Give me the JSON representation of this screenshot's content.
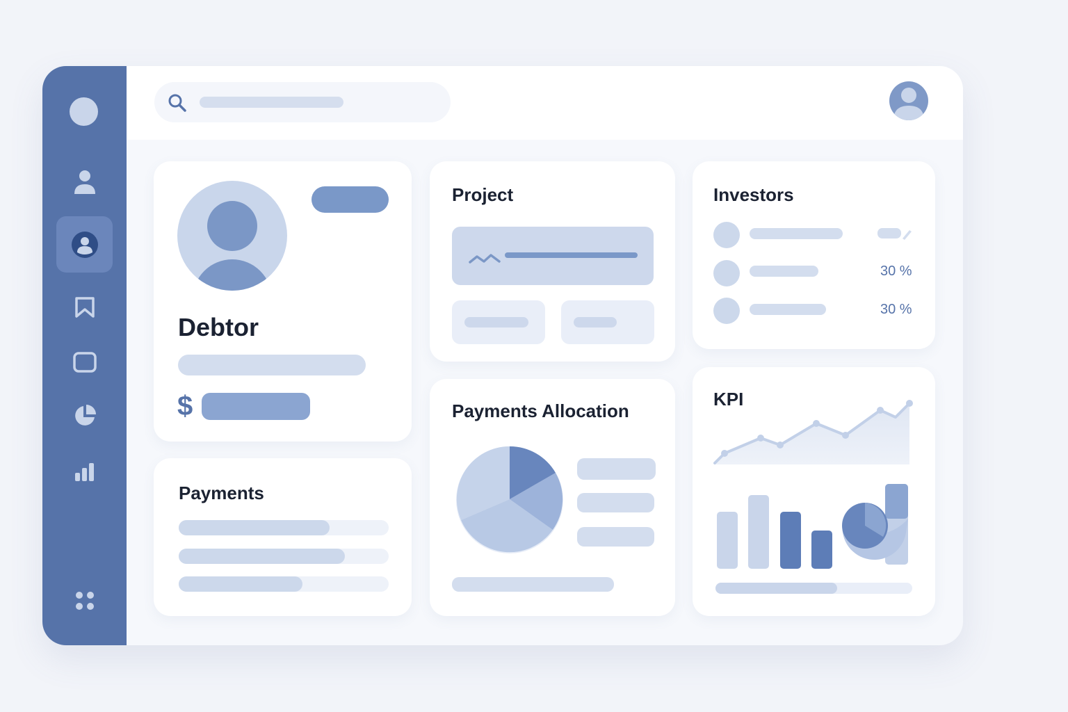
{
  "sidebar": {
    "items": [
      {
        "icon": "user-icon",
        "active": false
      },
      {
        "icon": "profile-icon",
        "active": true
      },
      {
        "icon": "bookmark-icon",
        "active": false
      },
      {
        "icon": "window-icon",
        "active": false
      },
      {
        "icon": "pie-chart-icon",
        "active": false
      },
      {
        "icon": "bar-chart-icon",
        "active": false
      }
    ],
    "bottom_icon": "apps-grid-icon"
  },
  "header": {
    "search_icon": "search-icon",
    "avatar_icon": "user-avatar-icon"
  },
  "debtor": {
    "title": "Debtor",
    "currency_symbol": "$"
  },
  "project": {
    "title": "Project"
  },
  "investors": {
    "title": "Investors",
    "rows": [
      {
        "pct": ""
      },
      {
        "pct": "30 %"
      },
      {
        "pct": "30 %"
      }
    ]
  },
  "payments": {
    "title": "Payments",
    "bars": [
      0.72,
      0.79,
      0.59
    ]
  },
  "allocation": {
    "title": "Payments Allocation"
  },
  "kpi": {
    "title": "KPI",
    "progress": 0.62
  },
  "colors": {
    "sidebar": "#5673a9",
    "accent": "#7a98c8",
    "light": "#d3ddee",
    "background": "#f2f4f9"
  }
}
